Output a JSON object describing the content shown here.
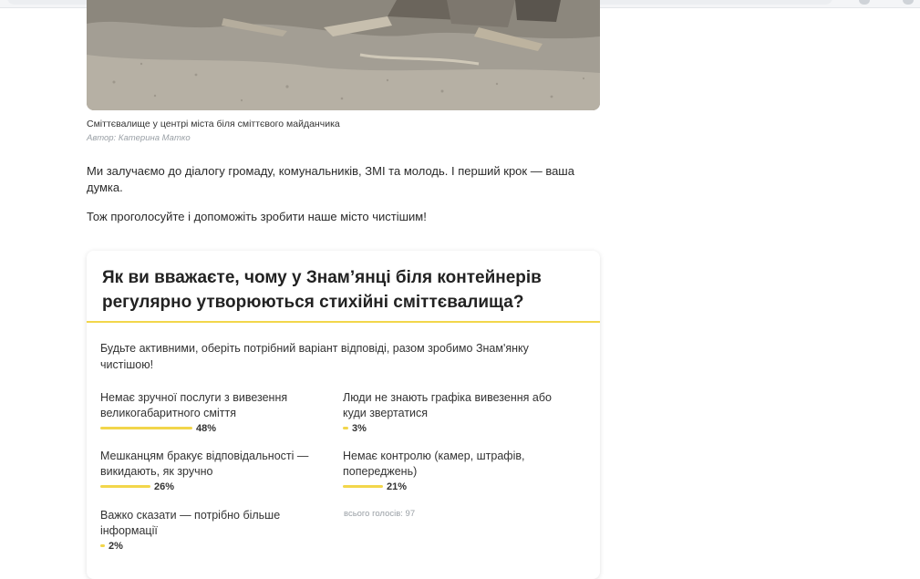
{
  "photo": {
    "caption": "Сміттєвалище у центрі міста біля сміттєвого майданчика",
    "credit": "Автор: Катерина Матко"
  },
  "article": {
    "paragraphs": [
      "Ми залучаємо до діалогу громаду, комунальників, ЗМІ та молодь. І перший крок — ваша думка.",
      "Тож проголосуйте і допоможіть зробити наше місто чистішим!"
    ]
  },
  "poll": {
    "question": "Як ви вважаєте, чому у Знам’янці біля контейнерів регулярно утворюються стихійні сміттєвалища?",
    "description": "Будьте активними, оберіть потрібний варіант відповіді, разом зробимо Знам'янку чистішою!",
    "options": [
      {
        "label": "Немає зручної послуги з вивезення великогабаритного сміття",
        "percent": 48,
        "percent_label": "48%"
      },
      {
        "label": "Люди не знають графіка вивезення або куди звертатися",
        "percent": 3,
        "percent_label": "3%"
      },
      {
        "label": "Мешканцям бракує відповідальності — викидають, як зручно",
        "percent": 26,
        "percent_label": "26%"
      },
      {
        "label": "Немає контролю (камер, штрафів, попереджень)",
        "percent": 21,
        "percent_label": "21%"
      },
      {
        "label": "Важко сказати — потрібно більше інформації",
        "percent": 2,
        "percent_label": "2%"
      }
    ],
    "total_votes_label": "всього голосів: 97",
    "accent_color": "#f2d64b"
  }
}
